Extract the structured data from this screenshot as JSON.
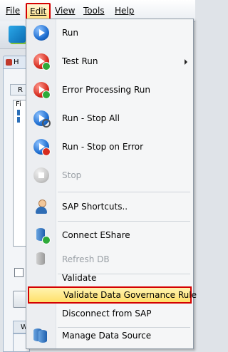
{
  "menubar": {
    "items": [
      {
        "label": "File",
        "mnemonic_index": 0
      },
      {
        "label": "Edit",
        "mnemonic_index": 0
      },
      {
        "label": "View",
        "mnemonic_index": 0
      },
      {
        "label": "Tools",
        "mnemonic_index": 0
      },
      {
        "label": "Help",
        "mnemonic_index": 0
      }
    ],
    "active": "Edit"
  },
  "background_app": {
    "tab_label": "H",
    "subtab_label": "R",
    "list_header": "Fi",
    "bottom_tab_label": "W"
  },
  "edit_menu": {
    "items": [
      {
        "label": "Run",
        "icon": "run-icon",
        "enabled": true
      },
      {
        "label": "Test Run",
        "icon": "test-run-icon",
        "enabled": true,
        "has_submenu": true
      },
      {
        "label": "Error Processing Run",
        "icon": "error-processing-run-icon",
        "enabled": true
      },
      {
        "label": "Run - Stop All",
        "icon": "run-stop-all-icon",
        "enabled": true
      },
      {
        "label": "Run - Stop on Error",
        "icon": "run-stop-on-error-icon",
        "enabled": true
      },
      {
        "label": "Stop",
        "icon": "stop-icon",
        "enabled": false
      },
      {
        "label": "SAP Shortcuts..",
        "icon": "sap-shortcuts-icon",
        "enabled": true
      },
      {
        "label": "Connect EShare",
        "icon": "connect-eshare-icon",
        "enabled": true
      },
      {
        "label": "Refresh DB",
        "icon": "refresh-db-icon",
        "enabled": false
      },
      {
        "label": "Validate",
        "icon": "",
        "enabled": true
      },
      {
        "label": "Validate Data Governance Rule",
        "icon": "",
        "enabled": true,
        "highlighted": true
      },
      {
        "label": "Disconnect from SAP",
        "icon": "",
        "enabled": true
      },
      {
        "label": "Manage Data Source",
        "icon": "manage-data-source-icon",
        "enabled": true
      }
    ]
  },
  "colors": {
    "highlight_border": "#d40000",
    "highlight_fill": "#ffe06a",
    "disabled_text": "#9aa0a6"
  }
}
